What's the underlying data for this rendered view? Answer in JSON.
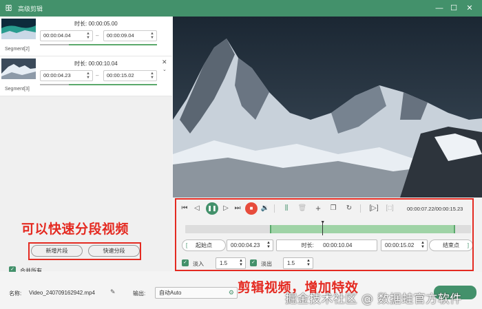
{
  "window": {
    "title": "高级剪辑",
    "logo": "rabbit-logo-icon"
  },
  "segments": [
    {
      "label": "Segment[2]",
      "duration_label": "时长:",
      "duration": "00:00:05.00",
      "start": "00:00:04.04",
      "end": "00:00:09.04",
      "progress": 0.75
    },
    {
      "label": "Segment[3]",
      "duration_label": "时长:",
      "duration": "00:00:10.04",
      "start": "00:00:04.23",
      "end": "00:00:15.02",
      "progress": 0.75
    }
  ],
  "left_buttons": {
    "add_segment": "新增片段",
    "quick_split": "快速分段"
  },
  "merge_all": "合并所有",
  "annotation_left": "可以快速分段视频",
  "annotation_right": "剪辑视频，增加特效",
  "player": {
    "time": "00:00:07.22/00:00:15.23"
  },
  "range": {
    "start_point_label": "起始点",
    "start": "00:00:04.23",
    "duration_label": "时长:",
    "duration": "00:00:10.04",
    "end": "00:00:15.02",
    "end_point_label": "结束点",
    "selection_start": 0.297,
    "selection_end": 0.944,
    "playhead": 0.48
  },
  "effects": {
    "fade_in_label": "淡入",
    "fade_in": "1.5",
    "fade_out_label": "淡出",
    "fade_out": "1.5"
  },
  "footer": {
    "name_label": "名称:",
    "name": "Video_240709162942.mp4",
    "output_label": "输出:",
    "output": "自动Auto"
  },
  "watermark": "掘金技术社区 @ 数据蛙官方软件",
  "colors": {
    "brand": "#43916b",
    "annotation": "#e42a21",
    "stop": "#e74c3c"
  }
}
